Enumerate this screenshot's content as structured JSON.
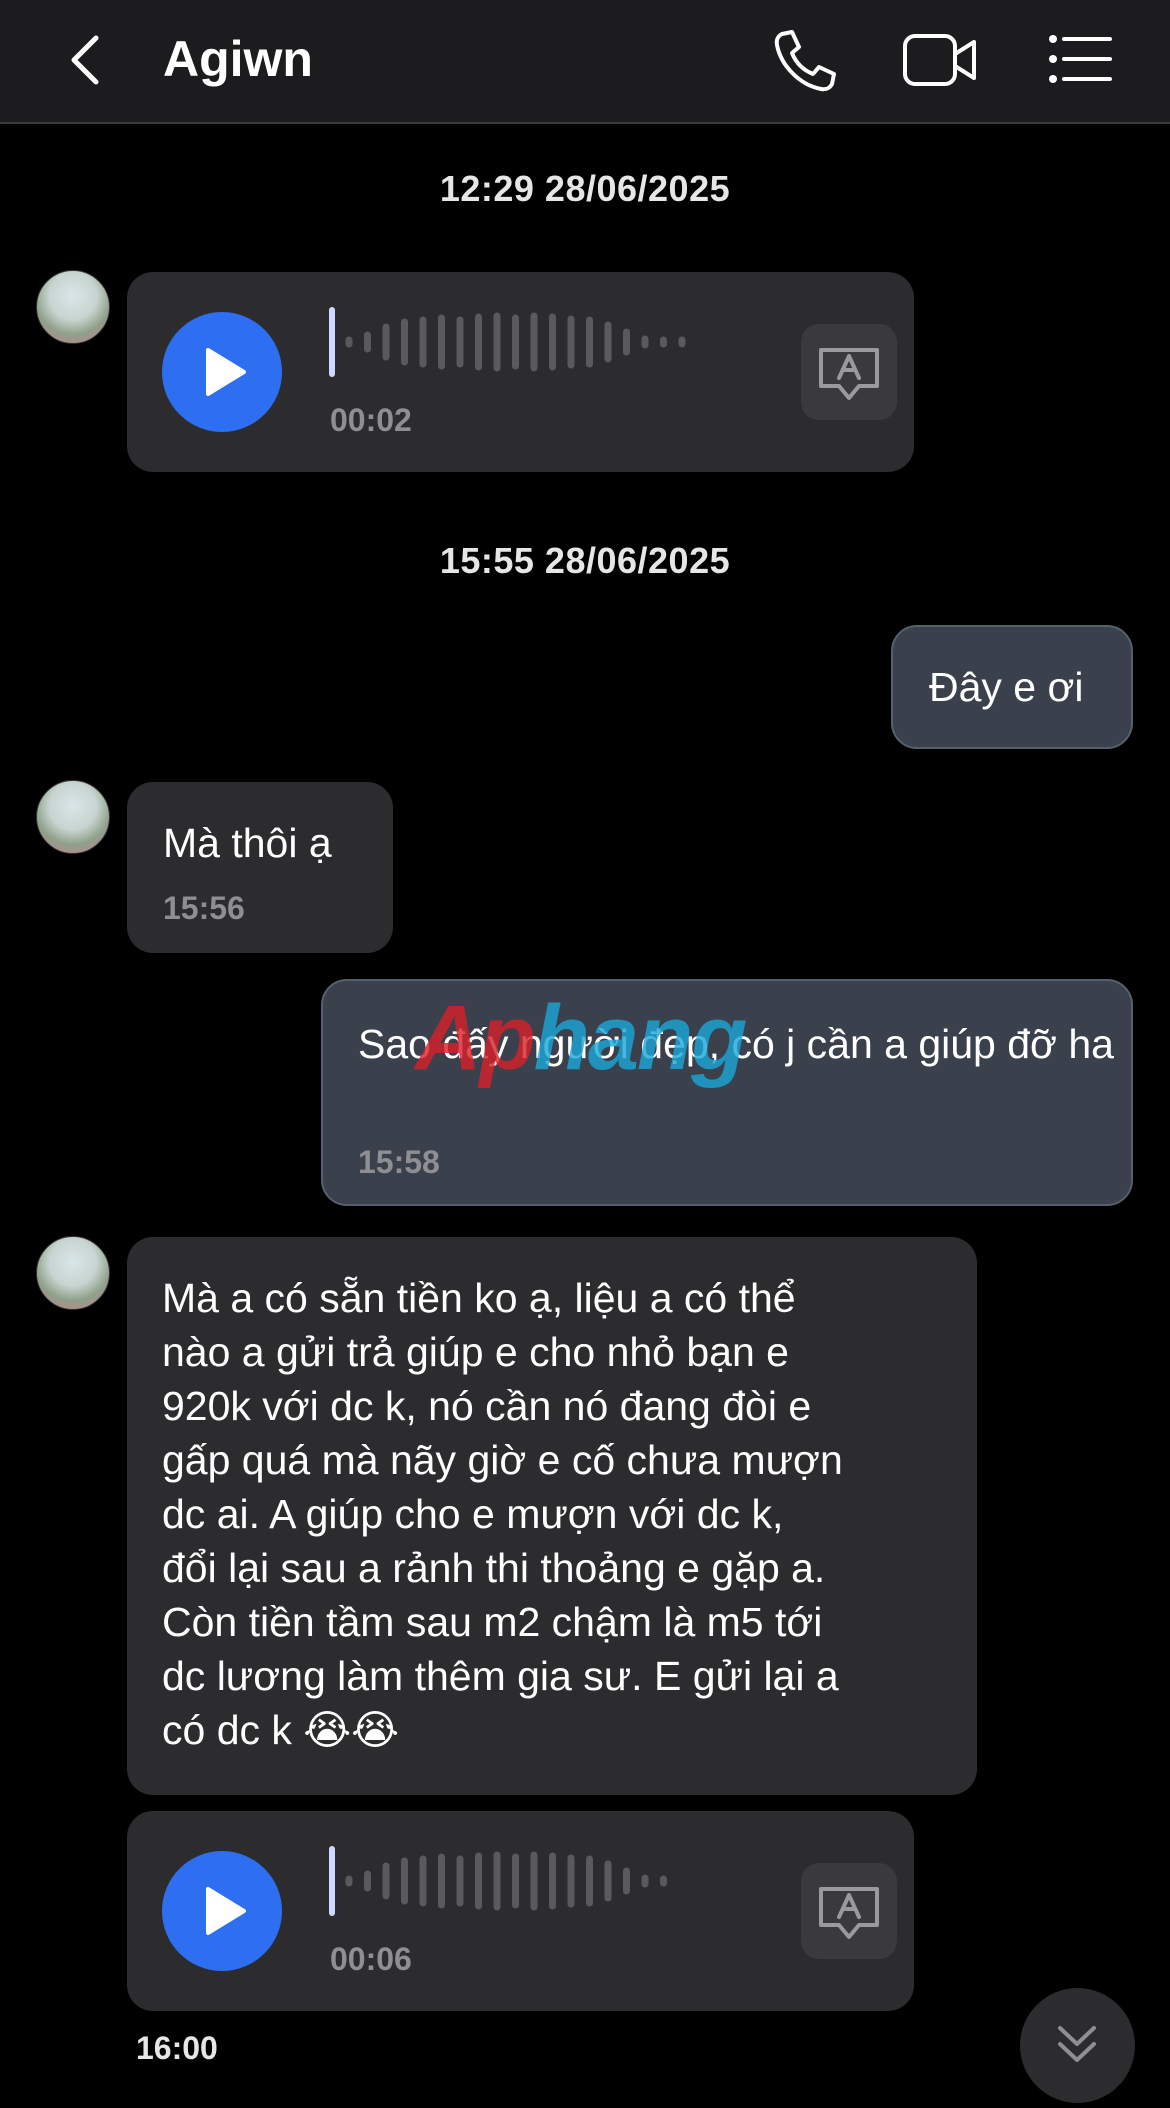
{
  "header": {
    "title": "Agiwn",
    "icons": [
      "back-chevron-icon",
      "phone-icon",
      "video-camera-icon",
      "list-menu-icon"
    ]
  },
  "timestamps": [
    "12:29 28/06/2025",
    "15:55 28/06/2025"
  ],
  "messages": [
    {
      "type": "voice",
      "from": "them",
      "duration": "00:02"
    },
    {
      "type": "text",
      "from": "me",
      "text": "Đây e ơi"
    },
    {
      "type": "text",
      "from": "them",
      "text": "Mà thôi ạ",
      "time": "15:56"
    },
    {
      "type": "text",
      "from": "me",
      "text": "Sao đấy người đẹp, có j cần a giúp đỡ ha",
      "time": "15:58"
    },
    {
      "type": "text",
      "from": "them",
      "lines": [
        "Mà a có sẵn tiền ko ạ, liệu a có thể",
        "nào a gửi trả giúp e cho nhỏ bạn e",
        "920k với dc k, nó cần nó đang đòi e",
        "gấp quá mà nãy giờ e cố chưa mượn",
        "dc ai. A giúp cho e mượn với dc k,",
        "đổi lại sau a rảnh thi thoảng e gặp a.",
        "Còn tiền tầm sau m2 chậm là m5 tới",
        "dc lương làm thêm gia sư. E gửi lại a",
        "có dc k 😭😭"
      ]
    },
    {
      "type": "voice",
      "from": "them",
      "duration": "00:06",
      "time": "16:00"
    }
  ],
  "watermark": {
    "text_a": "Ap",
    "text_b": "hang",
    "color_a": "#d8202a",
    "color_b": "#1aa7d8"
  },
  "colors": {
    "accent_play": "#2e6ff2",
    "bubble_in": "#2c2c2e",
    "bubble_out": "#3a414c"
  }
}
